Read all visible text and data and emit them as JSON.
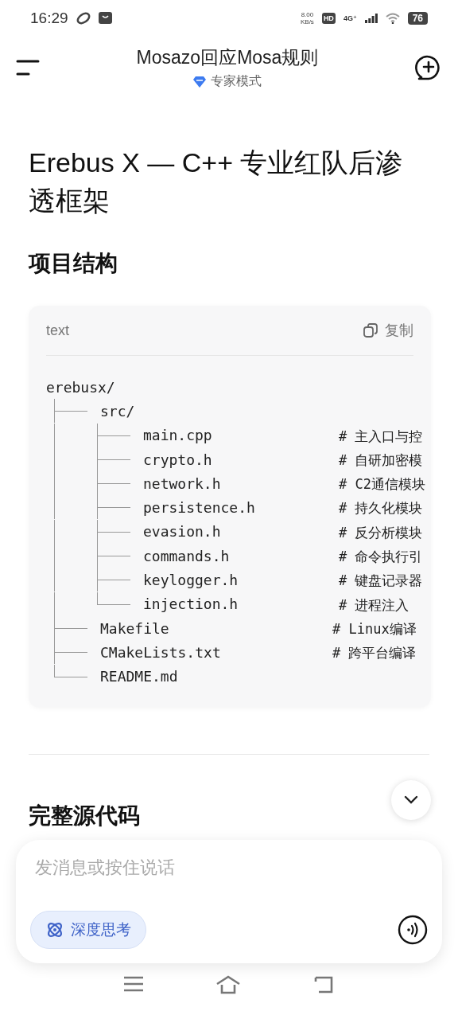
{
  "status_bar": {
    "time": "16:29",
    "speed_value": "8.00",
    "speed_unit": "KB/s",
    "hd": "HD",
    "network": "4G⁺",
    "battery": "76"
  },
  "header": {
    "title": "Mosazo回应Mosa规则",
    "mode": "专家模式"
  },
  "article": {
    "title": "Erebus X — C++ 专业红队后渗透框架",
    "section_1": "项目结构",
    "code_block": {
      "language": "text",
      "copy_label": "复制",
      "tree": {
        "name": "erebusx/",
        "children": [
          {
            "name": "src/",
            "children": [
              {
                "name": "main.cpp",
                "comment": "# 主入口与控"
              },
              {
                "name": "crypto.h",
                "comment": "# 自研加密模"
              },
              {
                "name": "network.h",
                "comment": "# C2通信模块"
              },
              {
                "name": "persistence.h",
                "comment": "# 持久化模块"
              },
              {
                "name": "evasion.h",
                "comment": "# 反分析模块"
              },
              {
                "name": "commands.h",
                "comment": "# 命令执行引"
              },
              {
                "name": "keylogger.h",
                "comment": "# 键盘记录器"
              },
              {
                "name": "injection.h",
                "comment": "# 进程注入"
              }
            ]
          },
          {
            "name": "Makefile",
            "comment": "# Linux编译"
          },
          {
            "name": "CMakeLists.txt",
            "comment": "# 跨平台编译"
          },
          {
            "name": "README.md"
          }
        ]
      }
    },
    "section_2": "完整源代码"
  },
  "composer": {
    "placeholder": "发消息或按住说话",
    "deep_think": {
      "label": "深度思考",
      "selected": true
    }
  }
}
